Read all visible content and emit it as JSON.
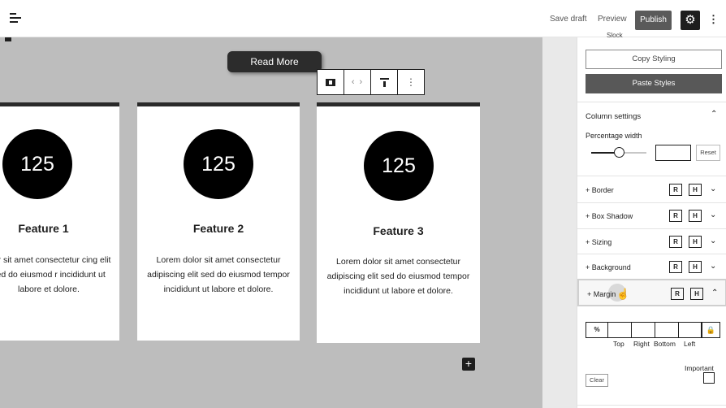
{
  "topbar": {
    "save_draft": "Save draft",
    "preview": "Preview",
    "publish": "Publish",
    "settings_icon": "gear-icon",
    "more_icon": "kebab-icon",
    "menu_icon": "list-view-icon"
  },
  "canvas": {
    "read_more": "Read More",
    "toolbar": {
      "columns_icon": "columns-icon",
      "nav_icon": "chevron-left-right-icon",
      "align_icon": "align-top-icon",
      "more_icon": "kebab-icon"
    },
    "cards": [
      {
        "number": "125",
        "title": "Feature 1",
        "body": "olor sit amet consectetur cing elit sed do eiusmod r incididunt ut labore et dolore."
      },
      {
        "number": "125",
        "title": "Feature 2",
        "body": "Lorem dolor sit amet consectetur adipiscing elit sed do eiusmod tempor incididunt ut labore et dolore."
      },
      {
        "number": "125",
        "title": "Feature 3",
        "body": "Lorem dolor sit amet consectetur adipiscing elit sed do eiusmod tempor incididunt ut labore et dolore."
      }
    ],
    "add_block": "+"
  },
  "sidebar": {
    "cutoff_text": "Slock",
    "copy_styling": "Copy Styling",
    "paste_styles": "Paste Styles",
    "column_settings": {
      "title": "Column settings",
      "percentage_label": "Percentage width",
      "percentage_value": "",
      "slider_level": 0.5,
      "reset": "Reset"
    },
    "panels": [
      {
        "label": "+ Border",
        "r": "R",
        "h": "H"
      },
      {
        "label": "+ Box Shadow",
        "r": "R",
        "h": "H"
      },
      {
        "label": "+ Sizing",
        "r": "R",
        "h": "H"
      },
      {
        "label": "+ Background",
        "r": "R",
        "h": "H"
      },
      {
        "label": "+ Margin",
        "r": "R",
        "h": "H"
      }
    ],
    "margin": {
      "unit": "%",
      "top": "",
      "right": "",
      "bottom": "",
      "left": "",
      "labels": [
        "Top",
        "Right",
        "Bottom",
        "Left"
      ],
      "lock_icon": "lock-icon",
      "important": "Important",
      "clear": "Clear"
    }
  }
}
